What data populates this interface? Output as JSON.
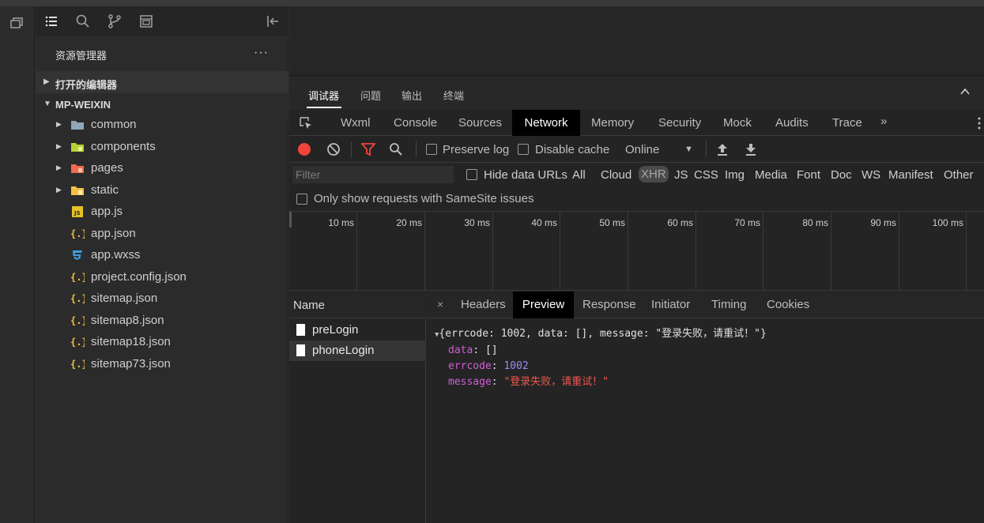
{
  "sidebar": {
    "explorer_title": "资源管理器",
    "more": "···",
    "sections": [
      {
        "label": "打开的编辑器"
      },
      {
        "label": "MP-WEIXIN"
      }
    ],
    "items": [
      {
        "label": "common",
        "type": "folder",
        "icon_color": "#8fa7b8"
      },
      {
        "label": "components",
        "type": "folder",
        "icon_color": "#b5d335"
      },
      {
        "label": "pages",
        "type": "folder",
        "icon_color": "#f26b4f"
      },
      {
        "label": "static",
        "type": "folder",
        "icon_color": "#f5c142"
      },
      {
        "label": "app.js",
        "type": "file",
        "icon": "js-icon"
      },
      {
        "label": "app.json",
        "type": "file",
        "icon": "json-icon"
      },
      {
        "label": "app.wxss",
        "type": "file",
        "icon": "css-icon"
      },
      {
        "label": "project.config.json",
        "type": "file",
        "icon": "json-icon"
      },
      {
        "label": "sitemap.json",
        "type": "file",
        "icon": "json-icon"
      },
      {
        "label": "sitemap8.json",
        "type": "file",
        "icon": "json-icon"
      },
      {
        "label": "sitemap18.json",
        "type": "file",
        "icon": "json-icon"
      },
      {
        "label": "sitemap73.json",
        "type": "file",
        "icon": "json-icon"
      }
    ]
  },
  "devtools": {
    "top_tabs": [
      "调试器",
      "问题",
      "输出",
      "终端"
    ],
    "panel_tabs": [
      "Wxml",
      "Console",
      "Sources",
      "Network",
      "Memory",
      "Security",
      "Mock",
      "Audits",
      "Trace"
    ],
    "active_panel": "Network",
    "more": "»",
    "toolbar": {
      "preserve_log": "Preserve log",
      "disable_cache": "Disable cache",
      "throttle": "Online"
    },
    "filter": {
      "placeholder": "Filter",
      "hide_data_urls": "Hide data URLs",
      "types": [
        "All",
        "Cloud",
        "XHR",
        "JS",
        "CSS",
        "Img",
        "Media",
        "Font",
        "Doc",
        "WS",
        "Manifest",
        "Other"
      ],
      "active_type": "XHR"
    },
    "samesite": "Only show requests with SameSite issues",
    "timeline": [
      "10 ms",
      "20 ms",
      "30 ms",
      "40 ms",
      "50 ms",
      "60 ms",
      "70 ms",
      "80 ms",
      "90 ms",
      "100 ms"
    ],
    "name_header": "Name",
    "requests": [
      "preLogin",
      "phoneLogin"
    ],
    "selected_request": "phoneLogin",
    "detail_tabs": [
      "Headers",
      "Preview",
      "Response",
      "Initiator",
      "Timing",
      "Cookies"
    ],
    "active_detail": "Preview",
    "close": "×",
    "preview": {
      "summary": "{errcode: 1002, data: [], message: \"登录失败，请重试！\"}",
      "data_key": "data",
      "data_val": "[]",
      "errcode_key": "errcode",
      "errcode_val": "1002",
      "message_key": "message",
      "message_val": "\"登录失败，请重试！\""
    }
  }
}
